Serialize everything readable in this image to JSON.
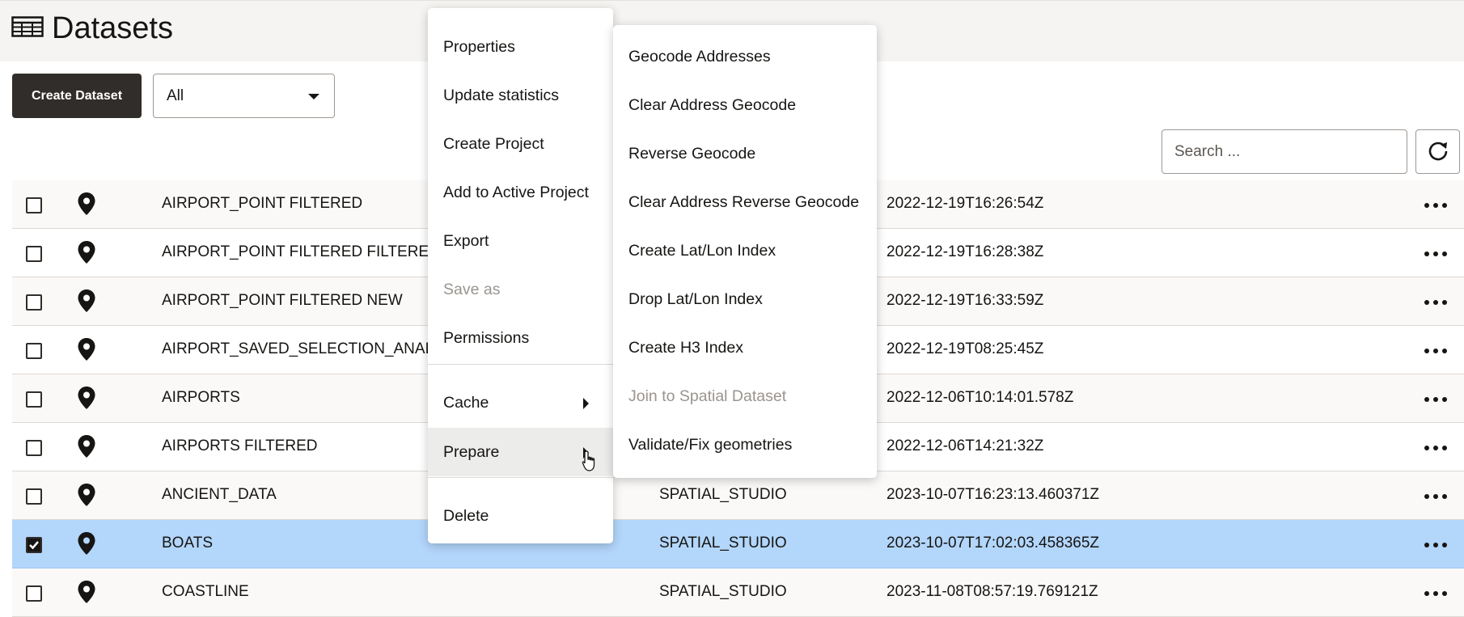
{
  "page": {
    "title": "Datasets"
  },
  "toolbar": {
    "create_label": "Create Dataset",
    "filter_value": "All",
    "search_placeholder": "Search ..."
  },
  "rows": [
    {
      "name": "AIRPORT_POINT FILTERED",
      "owner": "",
      "date": "2022-12-19T16:26:54Z",
      "selected": false
    },
    {
      "name": "AIRPORT_POINT FILTERED FILTERED",
      "owner": "",
      "date": "2022-12-19T16:28:38Z",
      "selected": false
    },
    {
      "name": "AIRPORT_POINT FILTERED NEW",
      "owner": "",
      "date": "2022-12-19T16:33:59Z",
      "selected": false
    },
    {
      "name": "AIRPORT_SAVED_SELECTION_ANALYSIS",
      "owner": "",
      "date": "2022-12-19T08:25:45Z",
      "selected": false
    },
    {
      "name": "AIRPORTS",
      "owner": "",
      "date": "2022-12-06T10:14:01.578Z",
      "selected": false
    },
    {
      "name": "AIRPORTS FILTERED",
      "owner": "",
      "date": "2022-12-06T14:21:32Z",
      "selected": false
    },
    {
      "name": "ANCIENT_DATA",
      "owner": "SPATIAL_STUDIO",
      "date": "2023-10-07T16:23:13.460371Z",
      "selected": false
    },
    {
      "name": "BOATS",
      "owner": "SPATIAL_STUDIO",
      "date": "2023-10-07T17:02:03.458365Z",
      "selected": true
    },
    {
      "name": "COASTLINE",
      "owner": "SPATIAL_STUDIO",
      "date": "2023-11-08T08:57:19.769121Z",
      "selected": false
    }
  ],
  "context_menu": {
    "items": [
      {
        "label": "Properties"
      },
      {
        "label": "Update statistics"
      },
      {
        "label": "Create Project"
      },
      {
        "label": "Add to Active Project"
      },
      {
        "label": "Export"
      },
      {
        "label": "Save as"
      },
      {
        "label": "Permissions"
      },
      {
        "label": "Cache"
      },
      {
        "label": "Prepare"
      },
      {
        "label": "Delete"
      }
    ]
  },
  "submenu": {
    "items": [
      {
        "label": "Geocode Addresses"
      },
      {
        "label": "Clear Address Geocode"
      },
      {
        "label": "Reverse Geocode"
      },
      {
        "label": "Clear Address Reverse Geocode"
      },
      {
        "label": "Create Lat/Lon Index"
      },
      {
        "label": "Drop Lat/Lon Index"
      },
      {
        "label": "Create H3 Index"
      },
      {
        "label": "Join to Spatial Dataset"
      },
      {
        "label": "Validate/Fix geometries"
      }
    ]
  },
  "colors": {
    "accent_dark": "#312d2a",
    "selected_row": "#b3d6fb",
    "disabled_text": "#9a948e"
  }
}
